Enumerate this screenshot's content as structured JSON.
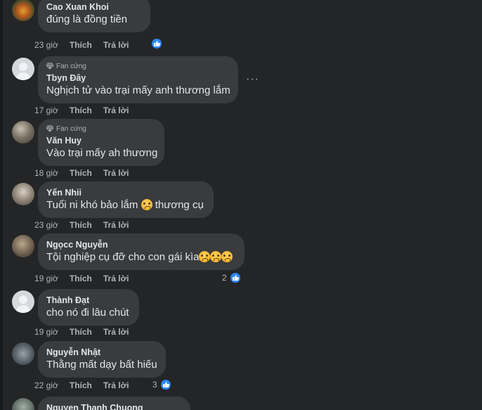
{
  "comments": [
    {
      "author": "Cao Xuan Khoi",
      "text": "đúng là đồng tiền",
      "time": "23 giờ",
      "like": "Thích",
      "reply": "Trả lời",
      "badge": "",
      "reactions": "",
      "avatar": "photo"
    },
    {
      "author": "Tbyn Đây",
      "text": "Nghịch tử vào trại mấy anh thương lắm",
      "time": "17 giờ",
      "like": "Thích",
      "reply": "Trả lời",
      "badge": "Fan cứng",
      "reactions": "",
      "avatar": "default"
    },
    {
      "author": "Văn Huy",
      "text": "Vào trại mấy ah thương",
      "time": "18 giờ",
      "like": "Thích",
      "reply": "Trả lời",
      "badge": "Fan cứng",
      "reactions": "",
      "avatar": "photo"
    },
    {
      "author": "Yến Nhii",
      "text_before": "Tuổi ni khó bảo lắm",
      "text_after": "thương cụ",
      "time": "23 giờ",
      "like": "Thích",
      "reply": "Trả lời",
      "badge": "",
      "reactions": "",
      "avatar": "photo"
    },
    {
      "author": "Ngọcc Nguyễn",
      "text": "Tội nghiệp cụ đỡ cho con gái kìa",
      "time": "19 giờ",
      "like": "Thích",
      "reply": "Trả lời",
      "badge": "",
      "reactions": "2",
      "avatar": "photo"
    },
    {
      "author": "Thành Đạt",
      "text": "cho nó đi lâu chút",
      "time": "19 giờ",
      "like": "Thích",
      "reply": "Trả lời",
      "badge": "",
      "reactions": "",
      "avatar": "default"
    },
    {
      "author": "Nguyễn Nhật",
      "text": "Thằng mất dạy bất hiếu",
      "time": "22 giờ",
      "like": "Thích",
      "reply": "Trả lời",
      "badge": "",
      "reactions": "3",
      "avatar": "photo"
    },
    {
      "author": "Nguyen Thanh Chuong",
      "text": "",
      "time": "",
      "like": "",
      "reply": "",
      "badge": "",
      "reactions": "",
      "avatar": "photo"
    }
  ],
  "icons": {
    "badge": "diamond-icon",
    "reaction": "like-thumb-icon",
    "emoji": "crying-face-icon",
    "more": "more-options-icon"
  },
  "colors": {
    "background": "#242526",
    "bubble": "#3a3b3c",
    "like_blue": "#2d88ff"
  }
}
